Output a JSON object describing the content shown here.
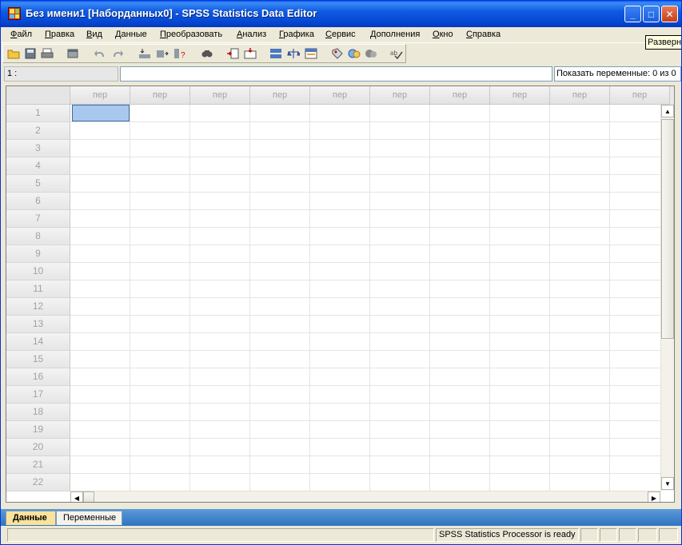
{
  "window": {
    "title": "Без имени1 [Наборданных0] - SPSS Statistics Data Editor",
    "minimize_glyph": "_",
    "maximize_glyph": "□",
    "close_glyph": "✕"
  },
  "tooltip": "Разверн",
  "menu": [
    "Файл",
    "Правка",
    "Вид",
    "Данные",
    "Преобразовать",
    "Анализ",
    "Графика",
    "Сервис",
    "Дополнения",
    "Окно",
    "Справка"
  ],
  "toolbar_icons": [
    "open-icon",
    "save-icon",
    "print-icon",
    "dialog-recall-icon",
    "undo-icon",
    "redo-icon",
    "goto-case-icon",
    "goto-variable-icon",
    "variables-icon",
    "find-icon",
    "insert-cases-icon",
    "insert-variable-icon",
    "split-file-icon",
    "weight-cases-icon",
    "select-cases-icon",
    "value-labels-icon",
    "use-sets-icon",
    "show-all-variables-icon",
    "spell-check-icon"
  ],
  "cellbar": {
    "cell_ref": "1 :",
    "cell_value": "",
    "show_vars": "Показать переменные: 0 из 0"
  },
  "grid": {
    "column_header": "пер",
    "column_count": 10,
    "rows": [
      "1",
      "2",
      "3",
      "4",
      "5",
      "6",
      "7",
      "8",
      "9",
      "10",
      "11",
      "12",
      "13",
      "14",
      "15",
      "16",
      "17",
      "18",
      "19",
      "20",
      "21",
      "22"
    ]
  },
  "tabs": {
    "data": "Данные",
    "variables": "Переменные"
  },
  "status": {
    "processor": "SPSS Statistics  Processor is ready"
  },
  "colors": {
    "title_bar": "#0a5ff0",
    "selected_cell": "#a9c8ee",
    "active_tab": "#fbe29b",
    "tab_bar": "#2f73bf"
  }
}
